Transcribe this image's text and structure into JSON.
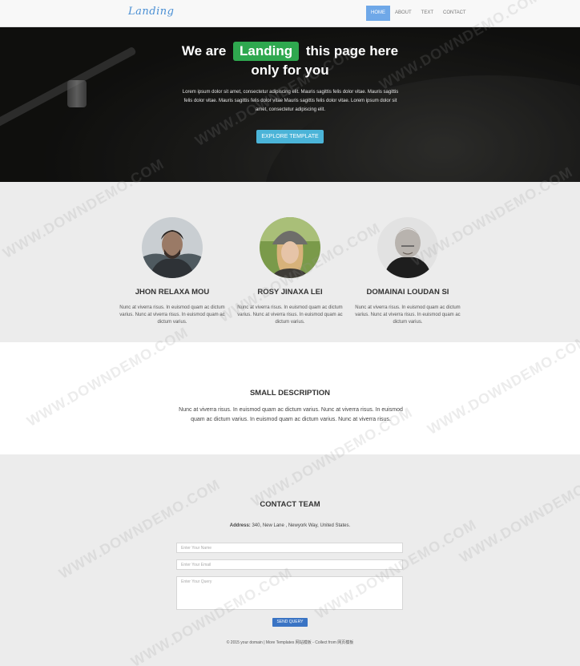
{
  "nav": {
    "brand": "Landing",
    "links": [
      {
        "label": "HOME",
        "active": true
      },
      {
        "label": "ABOUT",
        "active": false
      },
      {
        "label": "TEXT",
        "active": false
      },
      {
        "label": "CONTACT",
        "active": false
      }
    ]
  },
  "hero": {
    "title_pre": "We are",
    "title_highlight": "Landing",
    "title_post": "this page here",
    "title_line2": "only for you",
    "text": "Lorem ipsum dolor sit amet, consectetur adipiscing elit. Mauris sagittis felis dolor vitae. Mauris sagittis felis dolor vitae. Mauris sagittis felis dolor vitae Mauris sagittis felis dolor vitae. Lorem ipsum dolor sit amet, consectetur adipiscing elit.",
    "button": "EXPLORE TEMPLATE",
    "highlight_color": "#2fa84f"
  },
  "team": [
    {
      "name": "JHON RELAXA MOU",
      "desc": "Nunc at viverra risus. In euismod quam ac dictum varius. Nunc at viverra risus. In euismod quam ac dictum varius."
    },
    {
      "name": "ROSY JINAXA LEI",
      "desc": "Nunc at viverra risus. In euismod quam ac dictum varius. Nunc at viverra risus. In euismod quam ac dictum varius."
    },
    {
      "name": "DOMAINAI LOUDAN SI",
      "desc": "Nunc at viverra risus. In euismod quam ac dictum varius. Nunc at viverra risus. In euismod quam ac dictum varius."
    }
  ],
  "description": {
    "title": "SMALL DESCRIPTION",
    "text": "Nunc at viverra risus. In euismod quam ac dictum varius. Nunc at viverra risus. In euismod quam ac dictum varius. In euismod quam ac dictum varius. Nunc at viverra risus."
  },
  "contact": {
    "title": "CONTACT TEAM",
    "address_label": "Address:",
    "address_value": "340, New Lane , Newyork Way, United States.",
    "name_placeholder": "Enter Your Name",
    "email_placeholder": "Enter Your Email",
    "query_placeholder": "Enter Your Query",
    "button": "SEND QUERY",
    "footer": "© 2015 your domain | More Templates 网站模板 - Collect from 网页模板"
  },
  "watermark": "WWW.DOWNDEMO.COM"
}
